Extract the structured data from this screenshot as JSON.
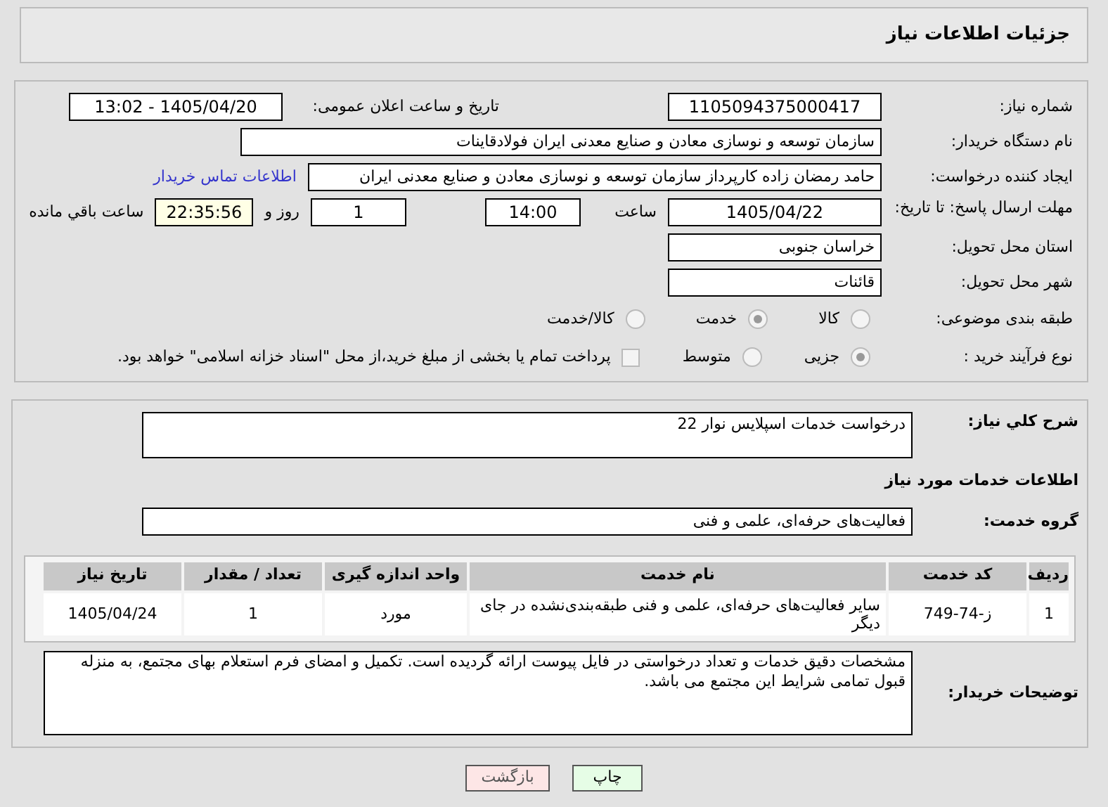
{
  "header": {
    "title": "جزئیات اطلاعات نیاز"
  },
  "details": {
    "need_number": {
      "label": "شماره نیاز:",
      "value": "1105094375000417"
    },
    "announce": {
      "label": "تاریخ و ساعت اعلان عمومی:",
      "value": "1405/04/20 - 13:02"
    },
    "buyer": {
      "label": "نام دستگاه خریدار:",
      "value": "سازمان توسعه و نوسازی معادن و صنایع معدنی ایران فولادقاینات"
    },
    "creator": {
      "label": "ایجاد کننده درخواست:",
      "value": "حامد  رمضان زاده  کارپرداز  سازمان توسعه و نوسازی معادن و صنایع معدنی ایران",
      "link": "اطلاعات تماس خریدار"
    },
    "deadline": {
      "label": "مهلت ارسال پاسخ: تا تاریخ:",
      "date": "1405/04/22",
      "time_label": "ساعت",
      "time": "14:00",
      "days": "1",
      "days_label": "روز و",
      "remaining": "22:35:56",
      "remaining_label": "ساعت باقي مانده"
    },
    "province": {
      "label": "استان محل تحویل:",
      "value": "خراسان جنوبی"
    },
    "city": {
      "label": "شهر محل تحویل:",
      "value": "قائنات"
    },
    "category": {
      "label": "طبقه بندی موضوعی:",
      "options": [
        {
          "label": "کالا",
          "selected": false
        },
        {
          "label": "خدمت",
          "selected": true
        },
        {
          "label": "کالا/خدمت",
          "selected": false
        }
      ]
    },
    "process": {
      "label": "نوع فرآیند خرید :",
      "options": [
        {
          "label": "جزیی",
          "selected": true
        },
        {
          "label": "متوسط",
          "selected": false
        }
      ],
      "treasury": {
        "label": "پرداخت تمام یا بخشی از مبلغ خرید،از محل \"اسناد خزانه اسلامی\" خواهد بود.",
        "checked": false
      }
    }
  },
  "services": {
    "description": {
      "label": "شرح کلي نياز:",
      "value": "درخواست خدمات اسپلایس نوار 22"
    },
    "heading": "اطلاعات خدمات مورد نیاز",
    "group": {
      "label": "گروه خدمت:",
      "value": "فعالیت‌های حرفه‌ای، علمی و فنی"
    },
    "table": {
      "columns": [
        "ردیف",
        "کد خدمت",
        "نام خدمت",
        "واحد اندازه گیری",
        "تعداد / مقدار",
        "تاریخ نیاز"
      ],
      "rows": [
        [
          "1",
          "ز-74-749",
          "سایر فعالیت‌های حرفه‌ای، علمی و فنی طبقه‌بندی‌نشده در جای دیگر",
          "مورد",
          "1",
          "1405/04/24"
        ]
      ]
    },
    "notes": {
      "label": "توضیحات خریدار:",
      "value": "مشخصات دقیق خدمات و تعداد درخواستی در فایل پیوست ارائه گردیده است. تکمیل و امضای فرم استعلام بهای مجتمع، به منزله قبول تمامی شرایط این مجتمع می باشد."
    }
  },
  "buttons": [
    {
      "label": "چاپ",
      "kind": "print"
    },
    {
      "label": "بازگشت",
      "kind": "back"
    }
  ]
}
